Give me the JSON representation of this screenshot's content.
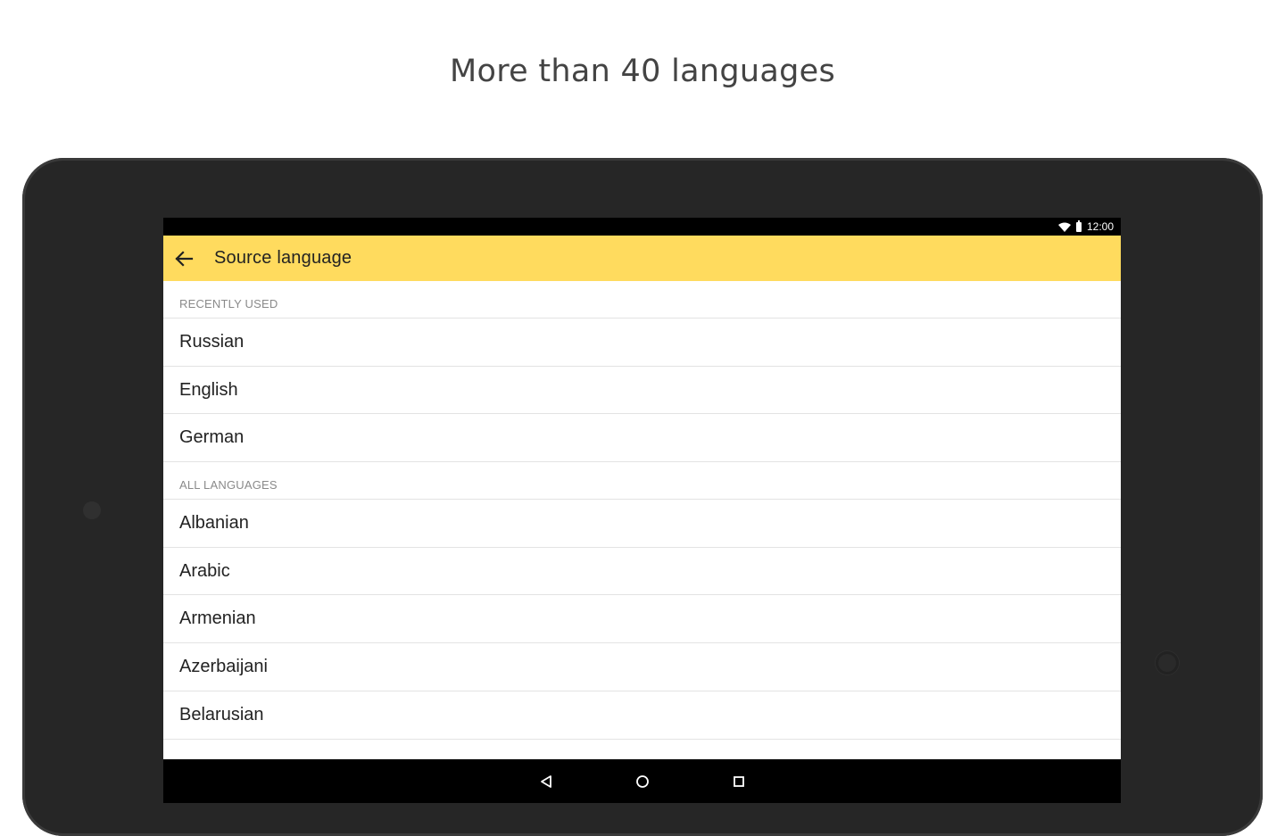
{
  "headline": "More than 40 languages",
  "status_bar": {
    "time": "12:00",
    "icons": [
      "wifi-icon",
      "battery-icon"
    ]
  },
  "app_bar": {
    "back_icon": "arrow-left-icon",
    "title": "Source language",
    "background_color": "#ffdb5e"
  },
  "sections": [
    {
      "header": "RECENTLY USED",
      "items": [
        "Russian",
        "English",
        "German"
      ]
    },
    {
      "header": "ALL LANGUAGES",
      "items": [
        "Albanian",
        "Arabic",
        "Armenian",
        "Azerbaijani",
        "Belarusian"
      ]
    }
  ],
  "nav_bar": {
    "buttons": [
      "back-triangle-icon",
      "home-circle-icon",
      "recents-square-icon"
    ]
  }
}
